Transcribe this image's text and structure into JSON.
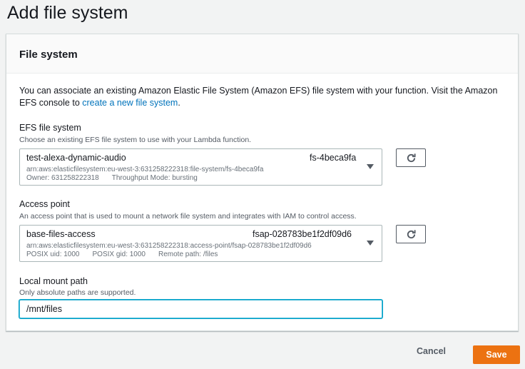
{
  "page": {
    "title": "Add file system"
  },
  "panel": {
    "title": "File system",
    "intro_text": "You can associate an existing Amazon Elastic File System (Amazon EFS) file system with your function. Visit the Amazon EFS console to ",
    "intro_link": "create a new file system",
    "intro_end": "."
  },
  "efs": {
    "label": "EFS file system",
    "description": "Choose an existing EFS file system to use with your Lambda function.",
    "selected_name": "test-alexa-dynamic-audio",
    "selected_id": "fs-4beca9fa",
    "arn": "arn:aws:elasticfilesystem:eu-west-3:631258222318:file-system/fs-4beca9fa",
    "owner": "Owner: 631258222318",
    "throughput": "Throughput Mode: bursting"
  },
  "access_point": {
    "label": "Access point",
    "description": "An access point that is used to mount a network file system and integrates with IAM to control access.",
    "selected_name": "base-files-access",
    "selected_id": "fsap-028783be1f2df09d6",
    "arn": "arn:aws:elasticfilesystem:eu-west-3:631258222318:access-point/fsap-028783be1f2df09d6",
    "posix_uid": "POSIX uid: 1000",
    "posix_gid": "POSIX gid: 1000",
    "remote_path": "Remote path: /files"
  },
  "mount": {
    "label": "Local mount path",
    "description": "Only absolute paths are supported.",
    "value": "/mnt/files"
  },
  "footer": {
    "cancel_label": "Cancel",
    "save_label": "Save"
  },
  "colors": {
    "primary": "#ec7211",
    "link": "#0073bb",
    "focus": "#00a1c9"
  },
  "icons": [
    "refresh-icon",
    "caret-down-icon"
  ]
}
